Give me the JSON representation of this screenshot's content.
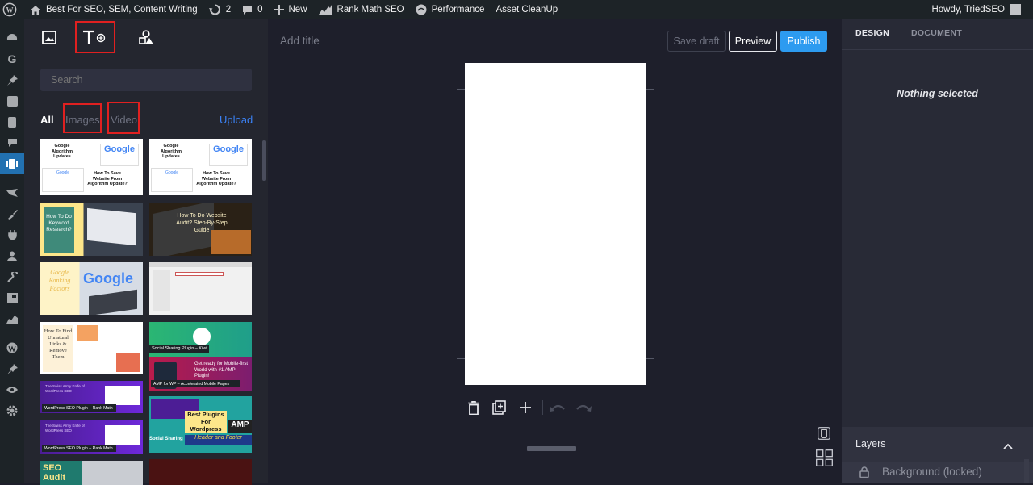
{
  "admin_bar": {
    "site_name": "Best For SEO, SEM, Content Writing",
    "updates_count": "2",
    "comments_count": "0",
    "new_label": "New",
    "rank_math_label": "Rank Math SEO",
    "performance_label": "Performance",
    "asset_cleanup_label": "Asset CleanUp",
    "howdy": "Howdy, TriedSEO"
  },
  "library": {
    "tabs": [
      "media-tab",
      "text-tab",
      "shapes-tab"
    ],
    "search_placeholder": "Search",
    "filters": {
      "all": "All",
      "images": "Images",
      "video": "Video"
    },
    "upload_label": "Upload",
    "media_items": [
      {
        "title": "Google Algorithm Updates",
        "subtitle": "How To Save Website From Algorithm Update?",
        "logo": "Google"
      },
      {
        "title": "Google Algorithm Updates",
        "subtitle": "How To Save Website From Algorithm Update?",
        "logo": "Google"
      },
      {
        "title": "How To Do Keyword Research?"
      },
      {
        "title": "How To Do Website Audit? Step-By-Step Guide"
      },
      {
        "title": "Google Ranking Factors",
        "logo": "Google"
      },
      {
        "title": ""
      },
      {
        "title": "How To Find Unnatural Links & Remove Them"
      },
      {
        "title": "Social Sharing Plugin – Kiwi"
      },
      {
        "title": "The Swiss Army Knife of WordPress SEO",
        "subtitle": "WordPress SEO Plugin – Rank Math"
      },
      {
        "title": "Get ready for Mobile-first World with #1 AMP Plugin!",
        "subtitle": "AMP for WP – Accelerated Mobile Pages"
      },
      {
        "title": "The Swiss Army Knife of WordPress SEO",
        "subtitle": "WordPress SEO Plugin – Rank Math"
      },
      {
        "title": "Best Plugins For Wordpress",
        "subtitle": "Social Sharing",
        "extra": "Header and Footer",
        "badge": "AMP"
      },
      {
        "title": "SEO Audit"
      },
      {
        "title": ""
      }
    ]
  },
  "editor": {
    "title_placeholder": "Add title",
    "save_draft": "Save draft",
    "preview": "Preview",
    "publish": "Publish"
  },
  "inspector": {
    "tabs": {
      "design": "DESIGN",
      "document": "DOCUMENT"
    },
    "nothing_selected": "Nothing selected",
    "layers_title": "Layers",
    "layer_background": "Background (locked)"
  },
  "colors": {
    "accent_blue": "#2d9bf0",
    "highlight_red": "#e02020",
    "upload_blue": "#3b82f6"
  }
}
